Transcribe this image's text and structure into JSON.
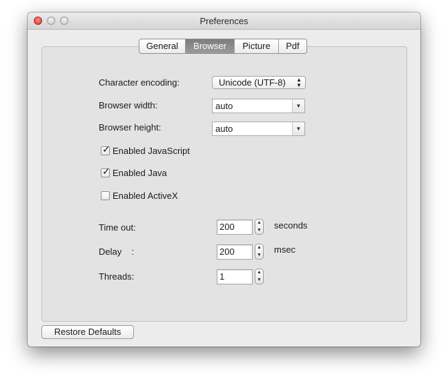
{
  "window": {
    "title": "Preferences"
  },
  "tabs": [
    {
      "label": "General",
      "selected": false
    },
    {
      "label": "Browser",
      "selected": true
    },
    {
      "label": "Picture",
      "selected": false
    },
    {
      "label": "Pdf",
      "selected": false
    }
  ],
  "browser": {
    "character_encoding": {
      "label": "Character encoding:",
      "value": "Unicode (UTF-8)",
      "icon": "up-down-arrows-icon"
    },
    "browser_width": {
      "label": "Browser width:",
      "value": "auto",
      "icon": "chevron-down-icon"
    },
    "browser_height": {
      "label": "Browser height:",
      "value": "auto",
      "icon": "chevron-down-icon"
    },
    "javascript": {
      "label": "Enabled JavaScript",
      "checked": true
    },
    "java": {
      "label": "Enabled Java",
      "checked": true
    },
    "activex": {
      "label": "Enabled ActiveX",
      "checked": false
    },
    "timeout": {
      "label": "Time out:",
      "value": "200",
      "unit": "seconds"
    },
    "delay": {
      "label": "Delay    :",
      "value": "200",
      "unit": "msec"
    },
    "threads": {
      "label": "Threads:",
      "value": "1"
    }
  },
  "footer": {
    "restore_label": "Restore Defaults"
  },
  "glyphs": {
    "check": "✓",
    "popup_arrows": "▲▼",
    "down": "▼",
    "up": "▲"
  },
  "colors": {
    "close": "#d6342c",
    "selected_tab": "#8a8a8a",
    "window_bg": "#ececec"
  }
}
